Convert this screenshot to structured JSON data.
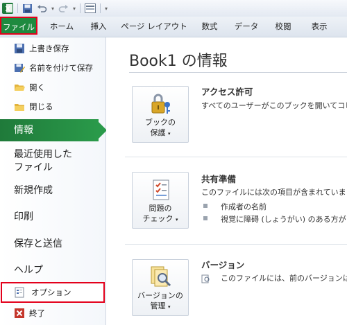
{
  "ribbon": {
    "file_tab": "ファイル",
    "tabs": [
      "ホーム",
      "挿入",
      "ページ レイアウト",
      "数式",
      "データ",
      "校閲",
      "表示"
    ]
  },
  "backstage": {
    "commands": [
      {
        "label": "上書き保存",
        "icon": "save-icon"
      },
      {
        "label": "名前を付けて保存",
        "icon": "save-as-icon"
      },
      {
        "label": "開く",
        "icon": "open-folder-icon"
      },
      {
        "label": "閉じる",
        "icon": "close-folder-icon"
      }
    ],
    "active_nav": "情報",
    "nav": {
      "recent_line1": "最近使用した",
      "recent_line2": "ファイル",
      "new": "新規作成",
      "print": "印刷",
      "save_send": "保存と送信",
      "help": "ヘルプ"
    },
    "options": "オプション",
    "exit": "終了"
  },
  "info": {
    "title": "Book1 の情報",
    "permissions": {
      "button_line1": "ブックの",
      "button_line2": "保護",
      "heading": "アクセス許可",
      "text": "すべてのユーザーがこのブックを開いてコピ"
    },
    "prepare": {
      "button_line1": "問題の",
      "button_line2": "チェック",
      "heading": "共有準備",
      "text": "このファイルには次の項目が含まれていま",
      "bullets": [
        "作成者の名前",
        "視覚に障碍 (しょうがい) のある方が"
      ]
    },
    "versions": {
      "button_line1": "バージョンの",
      "button_line2": "管理",
      "heading": "バージョン",
      "text": "このファイルには、前のバージョンはあ"
    }
  },
  "colors": {
    "accent_green": "#1e8a3f",
    "highlight_red": "#e3001b"
  }
}
